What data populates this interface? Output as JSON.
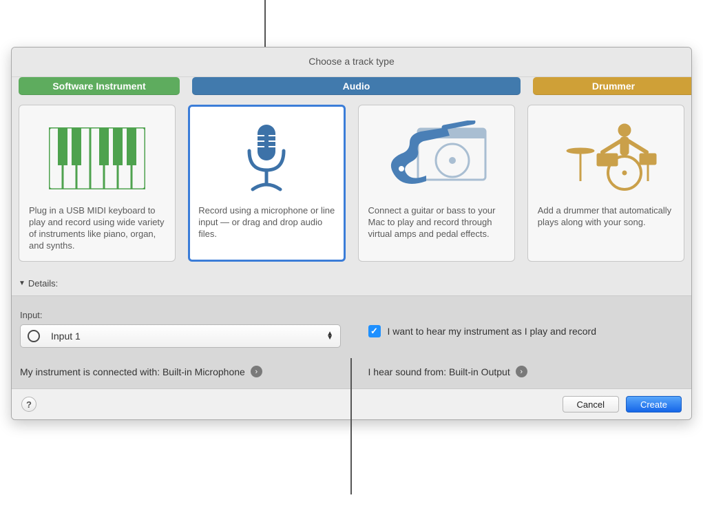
{
  "dialog": {
    "title": "Choose a track type",
    "tabs": {
      "software": "Software Instrument",
      "audio": "Audio",
      "drummer": "Drummer"
    },
    "cards": [
      {
        "desc": "Plug in a USB MIDI keyboard to play and record using wide variety of instruments like piano, organ, and synths."
      },
      {
        "desc": "Record using a microphone or line input — or drag and drop audio files."
      },
      {
        "desc": "Connect a guitar or bass to your Mac to play and record through virtual amps and pedal effects."
      },
      {
        "desc": "Add a drummer that automatically plays along with your song."
      }
    ],
    "details_label": "Details:",
    "input_label": "Input:",
    "input_value": "Input 1",
    "monitor_label": "I want to hear my instrument as I play and record",
    "connected_label": "My instrument is connected with: Built-in Microphone",
    "output_label": "I hear sound from: Built-in Output",
    "cancel": "Cancel",
    "create": "Create"
  }
}
